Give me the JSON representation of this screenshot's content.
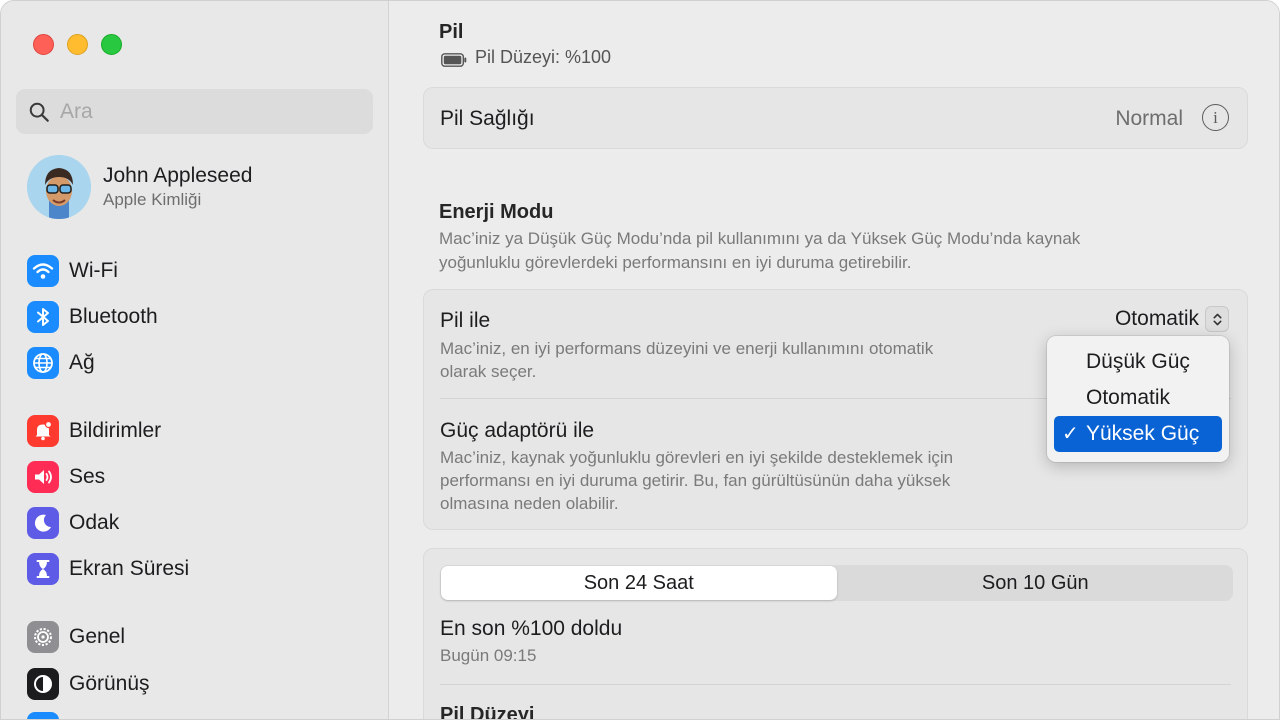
{
  "window": {
    "title": "Pil",
    "battery_level_label": "Pil Düzeyi: %100"
  },
  "sidebar": {
    "search_placeholder": "Ara",
    "profile": {
      "name": "John Appleseed",
      "subtitle": "Apple Kimliği"
    },
    "items": [
      {
        "label": "Wi-Fi",
        "icon": "wifi-icon",
        "color": "#1a8cff"
      },
      {
        "label": "Bluetooth",
        "icon": "bluetooth-icon",
        "color": "#1a8cff"
      },
      {
        "label": "Ağ",
        "icon": "globe-icon",
        "color": "#1a8cff"
      },
      {
        "label": "Bildirimler",
        "icon": "bell-icon",
        "color": "#ff3b30"
      },
      {
        "label": "Ses",
        "icon": "speaker-icon",
        "color": "#ff2d55"
      },
      {
        "label": "Odak",
        "icon": "moon-icon",
        "color": "#5e5ce6"
      },
      {
        "label": "Ekran Süresi",
        "icon": "hourglass-icon",
        "color": "#5e5ce6"
      },
      {
        "label": "Genel",
        "icon": "gear-icon",
        "color": "#8e8e93"
      },
      {
        "label": "Görünüş",
        "icon": "appearance-icon",
        "color": "#1c1c1e"
      }
    ]
  },
  "battery_health": {
    "label": "Pil Sağlığı",
    "value": "Normal"
  },
  "energy_mode": {
    "title": "Enerji Modu",
    "description_line1": "Mac’iniz ya Düşük Güç Modu’nda pil kullanımını ya da Yüksek Güç Modu’nda kaynak",
    "description_line2": "yoğunluklu görevlerdeki performansını en iyi duruma getirebilir.",
    "on_battery": {
      "label": "Pil ile",
      "value": "Otomatik",
      "desc_line1": "Mac’iniz, en iyi performans düzeyini ve enerji kullanımını otomatik",
      "desc_line2": "olarak seçer."
    },
    "on_adapter": {
      "label": "Güç adaptörü ile",
      "desc_line1": "Mac’iniz, kaynak yoğunluklu görevleri en iyi şekilde desteklemek için",
      "desc_line2": "performansı en iyi duruma getirir. Bu, fan gürültüsünün daha yüksek",
      "desc_line3": "olmasına neden olabilir."
    },
    "menu": {
      "options": [
        "Düşük Güç",
        "Otomatik",
        "Yüksek Güç"
      ],
      "selected": "Yüksek Güç",
      "check": "✓"
    }
  },
  "usage": {
    "tabs": [
      "Son 24 Saat",
      "Son 10 Gün"
    ],
    "active_tab": "Son 24 Saat",
    "last_charged_title": "En son %100 doldu",
    "last_charged_time": "Bugün 09:15",
    "battery_level_heading": "Pil Düzeyi"
  },
  "colors": {
    "accent": "#0a63d4",
    "traffic_red": "#fe5f57",
    "traffic_yellow": "#febc2e",
    "traffic_green": "#28c840"
  }
}
